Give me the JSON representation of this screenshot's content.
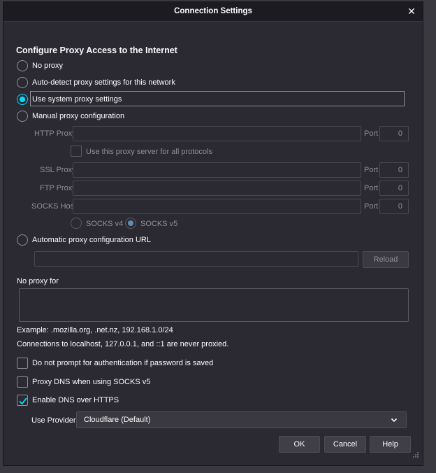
{
  "dialog": {
    "title": "Connection Settings",
    "close_glyph": "✕"
  },
  "section": {
    "heading": "Configure Proxy Access to the Internet"
  },
  "proxy_modes": {
    "no_proxy": "No proxy",
    "auto_detect": "Auto-detect proxy settings for this network",
    "system": "Use system proxy settings",
    "manual": "Manual proxy configuration",
    "auto_url": "Automatic proxy configuration URL",
    "selected": "system"
  },
  "manual": {
    "http_label": "HTTP Proxy",
    "http_value": "",
    "http_port_label": "Port",
    "http_port": "0",
    "share_label": "Use this proxy server for all protocols",
    "ssl_label": "SSL Proxy",
    "ssl_value": "",
    "ssl_port_label": "Port",
    "ssl_port": "0",
    "ftp_label": "FTP Proxy",
    "ftp_value": "",
    "ftp_port_label": "Port",
    "ftp_port": "0",
    "socks_label": "SOCKS Host",
    "socks_value": "",
    "socks_port_label": "Port",
    "socks_port": "0",
    "socks_v4": "SOCKS v4",
    "socks_v5": "SOCKS v5",
    "socks_selected": "v5"
  },
  "auto_url": {
    "value": "",
    "reload_label": "Reload"
  },
  "no_proxy": {
    "label": "No proxy for",
    "value": "",
    "example": "Example: .mozilla.org, .net.nz, 192.168.1.0/24",
    "note": "Connections to localhost, 127.0.0.1, and ::1 are never proxied."
  },
  "options": {
    "no_auth_prompt": "Do not prompt for authentication if password is saved",
    "no_auth_prompt_checked": false,
    "proxy_dns": "Proxy DNS when using SOCKS v5",
    "proxy_dns_checked": false,
    "doh": "Enable DNS over HTTPS",
    "doh_checked": true
  },
  "provider": {
    "label": "Use Provider",
    "selected": "Cloudflare (Default)"
  },
  "buttons": {
    "ok": "OK",
    "cancel": "Cancel",
    "help": "Help"
  },
  "colors": {
    "background": "#2b2a33",
    "titlebar": "#1c1b22",
    "accent": "#00ddff",
    "text": "#fbfbfe",
    "disabled_text": "#8f8f9d"
  },
  "icons": {
    "close": "close-icon",
    "dropdown": "chevron-down-icon",
    "check": "checkmark-icon",
    "resize": "resize-grip-icon"
  }
}
